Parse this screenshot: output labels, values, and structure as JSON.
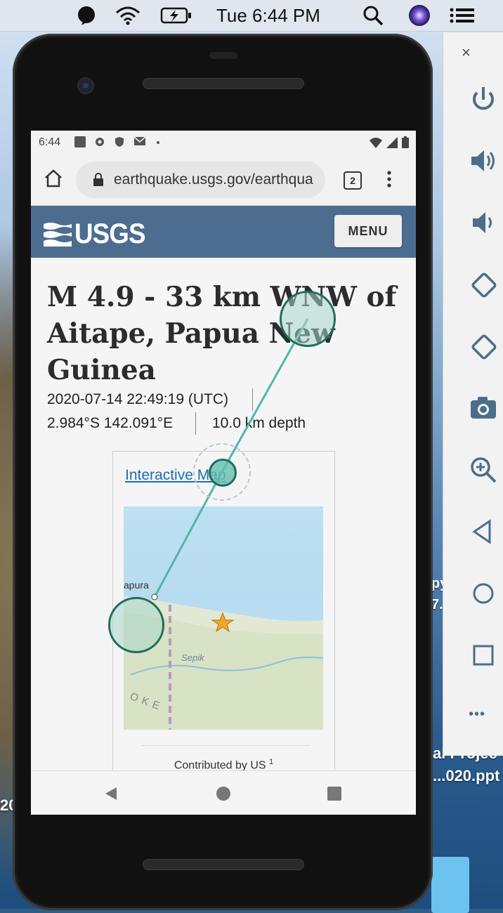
{
  "menubar": {
    "clock": "Tue 6:44 PM",
    "icons": [
      "alexa-icon",
      "wifi-icon",
      "battery-charging-icon",
      "spotlight-search-icon",
      "siri-icon",
      "control-center-icon"
    ]
  },
  "desktop": {
    "texts": [
      "al Projec",
      "...020.ppt",
      "20",
      "py",
      "7."
    ]
  },
  "phone": {
    "status": {
      "time": "6:44",
      "icons": [
        "image-icon",
        "settings-icon",
        "shield-icon",
        "gmail-icon",
        "dot-icon"
      ],
      "right_icons": [
        "wifi-icon",
        "signal-icon",
        "battery-icon"
      ]
    },
    "browser": {
      "url": "earthquake.usgs.gov/earthqua",
      "tab_count": "2"
    },
    "site": {
      "logo": "USGS",
      "menu_label": "MENU"
    },
    "event": {
      "title": "M 4.9 - 33 km WNW of Aitape, Papua New Guinea",
      "time": "2020-07-14 22:49:19 (UTC)",
      "location": "2.984°S 142.091°E",
      "depth": "10.0 km depth"
    },
    "map": {
      "link_label": "Interactive Map",
      "labels": [
        "apura",
        "Sepik",
        "OKE"
      ],
      "caption": "Contributed by US",
      "caption_sup": "1"
    }
  },
  "emulator": {
    "close": "×",
    "more": "•••",
    "buttons": [
      "power-icon",
      "volume-up-icon",
      "volume-down-icon",
      "rotate-left-icon",
      "rotate-right-icon",
      "camera-icon",
      "zoom-icon",
      "back-icon",
      "home-icon",
      "overview-icon"
    ]
  }
}
